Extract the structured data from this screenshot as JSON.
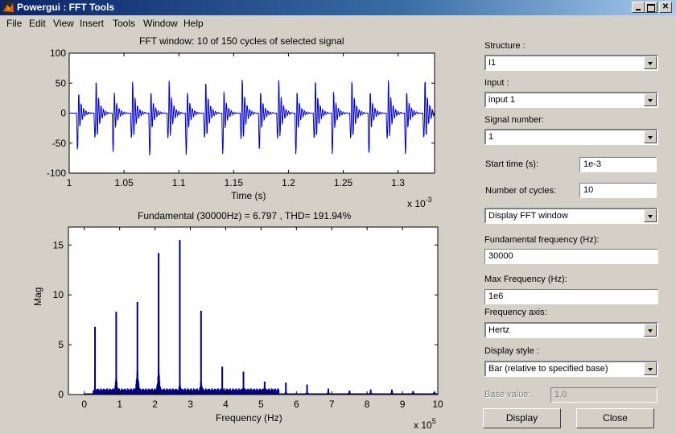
{
  "window": {
    "title": "Powergui : FFT Tools",
    "controls": [
      "minimize",
      "maximize",
      "close"
    ]
  },
  "menu": [
    "File",
    "Edit",
    "View",
    "Insert",
    "Tools",
    "Window",
    "Help"
  ],
  "colors": {
    "signal": "#0000cc",
    "spectrum": "#000080",
    "background": "#d4d0c8"
  },
  "chart_data": [
    {
      "type": "line",
      "title": "FFT window: 10 of 150 cycles of selected signal",
      "xlabel": "Time (s)",
      "ylabel": "",
      "x_multiplier": "x 10^-3",
      "xlim": [
        1.0,
        1.3333
      ],
      "ylim": [
        -100,
        100
      ],
      "xticks": [
        1,
        1.05,
        1.1,
        1.15,
        1.2,
        1.25,
        1.3
      ],
      "yticks": [
        100,
        50,
        0,
        -50,
        -100
      ],
      "xtick_labels": [
        "1",
        "1.05",
        "1.1",
        "1.15",
        "1.2",
        "1.25",
        "1.3"
      ],
      "ytick_labels": [
        "100",
        "50",
        "0",
        "-50",
        "-100"
      ],
      "cycles": 10,
      "period_ms": 0.03333,
      "description": "Periodic damped-ringing signal, 20 pulses (2 per cycle); positive spikes ~65-70, negative spikes ~-65 to -72",
      "pulse_peaks": [
        {
          "t": 1.0083,
          "min": -63,
          "max": 40
        },
        {
          "t": 1.0242,
          "min": -42,
          "max": 66
        },
        {
          "t": 1.0408,
          "min": -65,
          "max": 41
        },
        {
          "t": 1.0575,
          "min": -42,
          "max": 65
        },
        {
          "t": 1.0742,
          "min": -73,
          "max": 43
        },
        {
          "t": 1.0908,
          "min": -42,
          "max": 65
        },
        {
          "t": 1.1075,
          "min": -71,
          "max": 42
        },
        {
          "t": 1.1242,
          "min": -42,
          "max": 64
        },
        {
          "t": 1.1408,
          "min": -69,
          "max": 43
        },
        {
          "t": 1.1575,
          "min": -44,
          "max": 70
        },
        {
          "t": 1.1742,
          "min": -62,
          "max": 43
        },
        {
          "t": 1.1908,
          "min": -43,
          "max": 67
        },
        {
          "t": 1.2075,
          "min": -70,
          "max": 43
        },
        {
          "t": 1.2242,
          "min": -43,
          "max": 67
        },
        {
          "t": 1.2408,
          "min": -69,
          "max": 43
        },
        {
          "t": 1.2575,
          "min": -43,
          "max": 66
        },
        {
          "t": 1.2742,
          "min": -69,
          "max": 43
        },
        {
          "t": 1.2908,
          "min": -43,
          "max": 67
        },
        {
          "t": 1.3075,
          "min": -70,
          "max": 43
        },
        {
          "t": 1.3242,
          "min": -42,
          "max": 68
        }
      ]
    },
    {
      "type": "bar",
      "title": "Fundamental (30000Hz) = 6.797 , THD= 191.94%",
      "xlabel": "Frequency (Hz)",
      "ylabel": "Mag",
      "x_multiplier": "x 10^5",
      "xlim": [
        -0.45,
        10
      ],
      "ylim": [
        0,
        16.8
      ],
      "xticks": [
        0,
        1,
        2,
        3,
        4,
        5,
        6,
        7,
        8,
        9,
        10
      ],
      "yticks": [
        0,
        5,
        10,
        15
      ],
      "xtick_labels": [
        "0",
        "1",
        "2",
        "3",
        "4",
        "5",
        "6",
        "7",
        "8",
        "9",
        "10"
      ],
      "ytick_labels": [
        "0",
        "5",
        "10",
        "15"
      ],
      "fundamental_hz": 30000,
      "fundamental_mag": 6.797,
      "thd_percent": 191.94,
      "harmonics": [
        {
          "f": 0.3,
          "mag": 6.8
        },
        {
          "f": 0.9,
          "mag": 8.3
        },
        {
          "f": 1.5,
          "mag": 9.3
        },
        {
          "f": 2.1,
          "mag": 14.2
        },
        {
          "f": 2.7,
          "mag": 15.5
        },
        {
          "f": 3.3,
          "mag": 8.4
        },
        {
          "f": 3.9,
          "mag": 2.8
        },
        {
          "f": 4.5,
          "mag": 2.3
        },
        {
          "f": 5.1,
          "mag": 1.3
        },
        {
          "f": 5.7,
          "mag": 1.2
        },
        {
          "f": 6.3,
          "mag": 1.0
        },
        {
          "f": 6.9,
          "mag": 0.6
        },
        {
          "f": 7.5,
          "mag": 0.4
        },
        {
          "f": 8.1,
          "mag": 0.5
        },
        {
          "f": 8.7,
          "mag": 0.5
        },
        {
          "f": 9.3,
          "mag": 0.35
        },
        {
          "f": 9.9,
          "mag": 0.25
        }
      ]
    }
  ],
  "panel": {
    "structure": {
      "label": "Structure :",
      "value": "I1"
    },
    "input": {
      "label": "Input :",
      "value": "input 1"
    },
    "signal_number": {
      "label": "Signal number:",
      "value": "1"
    },
    "start_time": {
      "label": "Start time (s):",
      "value": "1e-3"
    },
    "num_cycles": {
      "label": "Number of cycles:",
      "value": "10"
    },
    "display_mode": {
      "value": "Display FFT window"
    },
    "fundamental_freq": {
      "label": "Fundamental frequency (Hz):",
      "value": "30000"
    },
    "max_freq": {
      "label": "Max Frequency (Hz):",
      "value": "1e6"
    },
    "freq_axis": {
      "label": "Frequency axis:",
      "value": "Hertz"
    },
    "display_style": {
      "label": "Display style :",
      "value": "Bar (relative to specified base)"
    },
    "base_value": {
      "label": "Base value:",
      "value": "1.0"
    },
    "display_button": "Display",
    "close_button": "Close"
  }
}
